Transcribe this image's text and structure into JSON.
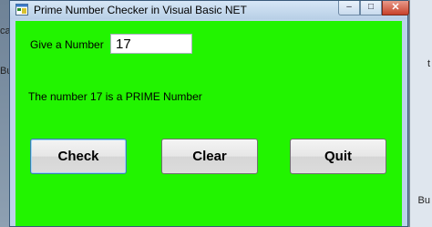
{
  "background": {
    "left_texts": [
      "ca",
      "Bu"
    ],
    "right_texts": [
      "t",
      "Bu"
    ]
  },
  "window": {
    "title": "Prime Number Checker in Visual Basic NET",
    "minimize_glyph": "–",
    "maximize_glyph": "□",
    "close_glyph": "✕"
  },
  "form": {
    "give_label": "Give a Number",
    "number_value": "17",
    "result_text": "The number 17 is a PRIME Number",
    "buttons": {
      "check": "Check",
      "clear": "Clear",
      "quit": "Quit"
    }
  },
  "colors": {
    "form_background": "#22f400"
  },
  "icons": {
    "app": "form-app-icon"
  }
}
